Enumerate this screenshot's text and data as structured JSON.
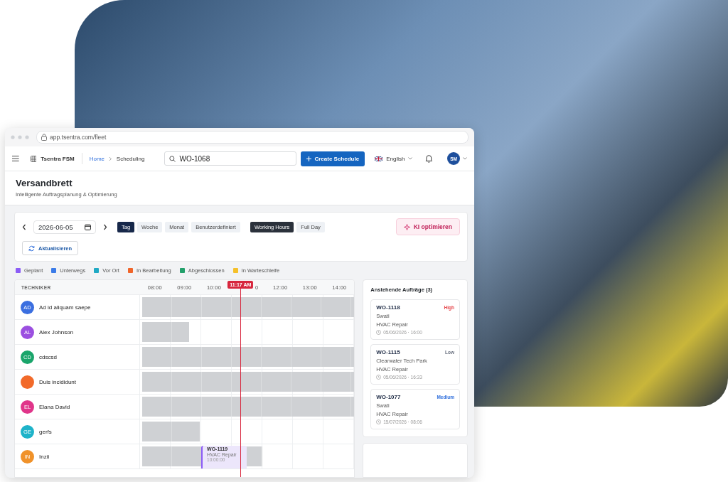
{
  "browser": {
    "url": "app.tsentra.com/fleet"
  },
  "header": {
    "app_name": "Tsentra FSM",
    "breadcrumb": [
      "Home",
      "Scheduling"
    ],
    "search": {
      "value": "WO-1068"
    },
    "create_button": "Create Schedule",
    "language": "English",
    "user_initials": "SM"
  },
  "page": {
    "title": "Versandbrett",
    "subtitle": "Intelligente Auftragsplanung & Optimierung"
  },
  "toolbar": {
    "date": "2026-06-05",
    "views": [
      {
        "label": "Tag",
        "selected": true
      },
      {
        "label": "Woche",
        "selected": false
      },
      {
        "label": "Monat",
        "selected": false
      },
      {
        "label": "Benutzerdefiniert",
        "selected": false
      }
    ],
    "ranges": [
      {
        "label": "Working Hours",
        "selected": true
      },
      {
        "label": "Full Day",
        "selected": false
      }
    ],
    "optimize_button": "KI optimieren",
    "refresh_button": "Aktualisieren"
  },
  "legend": [
    {
      "label": "Geplant",
      "color": "#8b5cf6"
    },
    {
      "label": "Unterwegs",
      "color": "#3b7be8"
    },
    {
      "label": "Vor Ort",
      "color": "#1fa9c4"
    },
    {
      "label": "In Bearbeitung",
      "color": "#f0652a"
    },
    {
      "label": "Abgeschlossen",
      "color": "#22a06b"
    },
    {
      "label": "In Warteschleife",
      "color": "#f5c02a"
    }
  ],
  "schedule": {
    "column_header": "TECHNIKER",
    "hours": [
      {
        "label": "08:00",
        "covered": false
      },
      {
        "label": "09:00",
        "covered": false
      },
      {
        "label": "10:00",
        "covered": false
      },
      {
        "label": "0",
        "covered": true
      },
      {
        "label": "12:00",
        "covered": false
      },
      {
        "label": "13:00",
        "covered": false
      },
      {
        "label": "14:00",
        "covered": false
      }
    ],
    "now": "11:17 AM",
    "rows": [
      {
        "initials": "AD",
        "name": "Ad id aliquam saepe",
        "color": "#3b6fe0",
        "level": 1
      },
      {
        "initials": "AL",
        "name": "Alex Johnson",
        "color": "#9b4fe0",
        "level": 0.22
      },
      {
        "initials": "CD",
        "name": "cdscsd",
        "color": "#1aa56b",
        "level": 1
      },
      {
        "name": "Duis incididunt",
        "color": "#f26a2a",
        "level": 1
      },
      {
        "initials": "EL",
        "name": "Elana David",
        "color": "#e0358a",
        "level": 1
      },
      {
        "initials": "GE",
        "name": "gerfs",
        "color": "#1eb3c9",
        "level": 0.27
      },
      {
        "initials": "IN",
        "name": "Inzii",
        "color": "#f0922a",
        "level": 0.56,
        "jobs": [
          {
            "id": "WO-1119",
            "type": "HVAC Repair",
            "start": "10:00:00",
            "color": "#8b5cf6"
          }
        ]
      }
    ]
  },
  "pending": {
    "title": "Anstehende Aufträge (3)",
    "orders": [
      {
        "id": "WO-1118",
        "priority": "High",
        "kind": "high",
        "customer": "Swati",
        "type": "HVAC Repair",
        "due": "05/06/2026 · 16:00"
      },
      {
        "id": "WO-1115",
        "priority": "Low",
        "kind": "low",
        "customer": "Clearwater Tech Park",
        "type": "HVAC Repair",
        "due": "05/06/2026 · 16:33"
      },
      {
        "id": "WO-1077",
        "priority": "Medium",
        "kind": "medium",
        "customer": "Swati",
        "type": "HVAC Repair",
        "due": "15/07/2026 · 08:06"
      }
    ]
  }
}
